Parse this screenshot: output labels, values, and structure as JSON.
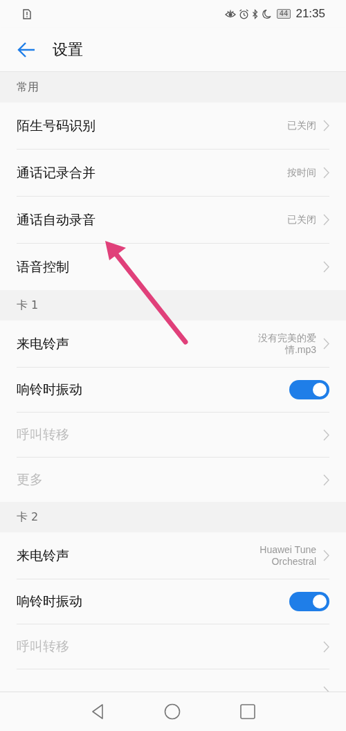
{
  "status_bar": {
    "time": "21:35",
    "battery": "44"
  },
  "header": {
    "title": "设置"
  },
  "sections": [
    {
      "title": "常用",
      "rows": [
        {
          "kind": "link",
          "label": "陌生号码识别",
          "value": "已关闭",
          "disabled": false
        },
        {
          "kind": "link",
          "label": "通话记录合并",
          "value": "按时间",
          "disabled": false
        },
        {
          "kind": "link",
          "label": "通话自动录音",
          "value": "已关闭",
          "disabled": false
        },
        {
          "kind": "link",
          "label": "语音控制",
          "disabled": false
        }
      ]
    },
    {
      "title": "卡 1",
      "rows": [
        {
          "kind": "link",
          "label": "来电铃声",
          "value": "没有完美的爱情.mp3",
          "disabled": false
        },
        {
          "kind": "toggle",
          "label": "响铃时振动",
          "on": true,
          "disabled": false
        },
        {
          "kind": "link",
          "label": "呼叫转移",
          "disabled": true
        },
        {
          "kind": "link",
          "label": "更多",
          "disabled": true
        }
      ]
    },
    {
      "title": "卡 2",
      "rows": [
        {
          "kind": "link",
          "label": "来电铃声",
          "value": "Huawei Tune Orchestral",
          "disabled": false
        },
        {
          "kind": "toggle",
          "label": "响铃时振动",
          "on": true,
          "disabled": false
        },
        {
          "kind": "link",
          "label": "呼叫转移",
          "disabled": true
        },
        {
          "kind": "link"
        }
      ]
    }
  ]
}
